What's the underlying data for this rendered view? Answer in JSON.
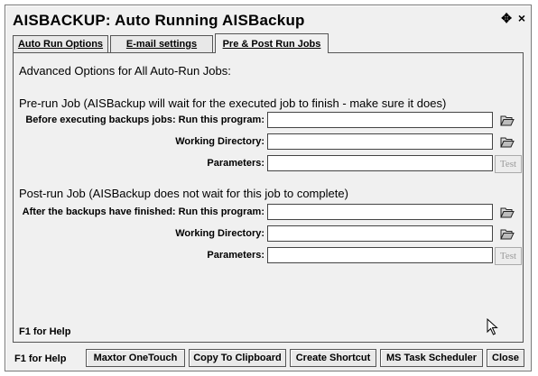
{
  "window": {
    "title": "AISBACKUP: Auto Running AISBackup",
    "controls": {
      "move": "✥",
      "close": "×"
    }
  },
  "tabs": [
    {
      "label": "Auto Run Options"
    },
    {
      "label": "E-mail settings"
    },
    {
      "label": "Pre & Post Run Jobs",
      "active": true
    }
  ],
  "panel": {
    "advanced_heading": "Advanced Options for All Auto-Run Jobs:",
    "pre_run": {
      "heading": "Pre-run Job (AISBackup will wait for the executed job to finish - make sure it does)",
      "program_label": "Before executing backups jobs: Run this program:",
      "program_value": "",
      "workdir_label": "Working Directory:",
      "workdir_value": "",
      "params_label": "Parameters:",
      "params_value": "",
      "test_label": "Test"
    },
    "post_run": {
      "heading": "Post-run Job (AISBackup does not wait for this job to complete)",
      "program_label": "After the backups have finished: Run this program:",
      "program_value": "",
      "workdir_label": "Working Directory:",
      "workdir_value": "",
      "params_label": "Parameters:",
      "params_value": "",
      "test_label": "Test"
    },
    "help_text": "F1 for Help"
  },
  "bottom": {
    "help_text": "F1 for Help",
    "buttons": [
      {
        "label": "Maxtor OneTouch"
      },
      {
        "label": "Copy To Clipboard"
      },
      {
        "label": "Create Shortcut"
      },
      {
        "label": "MS Task Scheduler"
      },
      {
        "label": "Close"
      }
    ]
  },
  "icons": {
    "browse": "folder-open-icon",
    "cursor": "mouse-pointer-icon"
  }
}
